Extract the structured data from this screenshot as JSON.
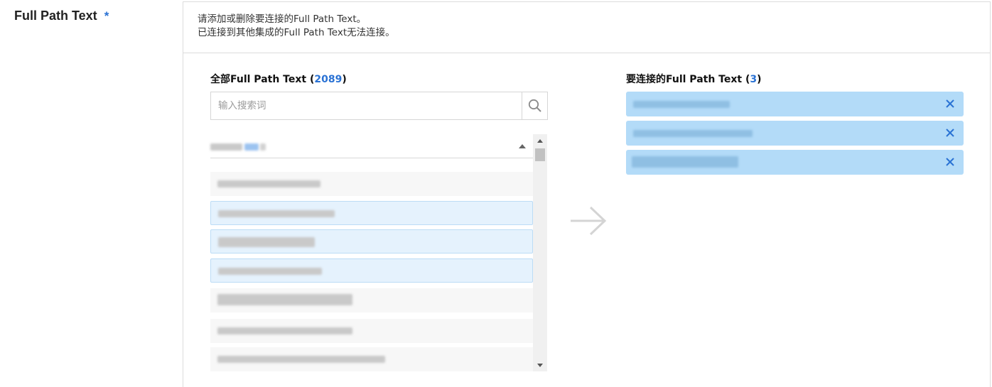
{
  "field": {
    "label": "Full Path Text",
    "required_mark": "*"
  },
  "description": {
    "line1": "请添加或删除要连接的Full Path Text。",
    "line2": "已连接到其他集成的Full Path Text无法连接。"
  },
  "available": {
    "title_prefix": "全部Full Path Text (",
    "count": "2089",
    "title_suffix": ")",
    "search_placeholder": "输入搜索词",
    "search_icon": "magnifier-icon",
    "item_count_visible": 7,
    "selected_rows": [
      2,
      3,
      4
    ]
  },
  "connected": {
    "title_prefix": "要连接的Full Path Text (",
    "count": "3",
    "title_suffix": ")",
    "remove_icon": "close-icon"
  },
  "colors": {
    "accent": "#2a72d4",
    "chip_bg": "#b3dbf8",
    "selected_row_bg": "#e5f2fd",
    "row_bg": "#f7f7f7",
    "arrow": "#d4d4d4"
  }
}
